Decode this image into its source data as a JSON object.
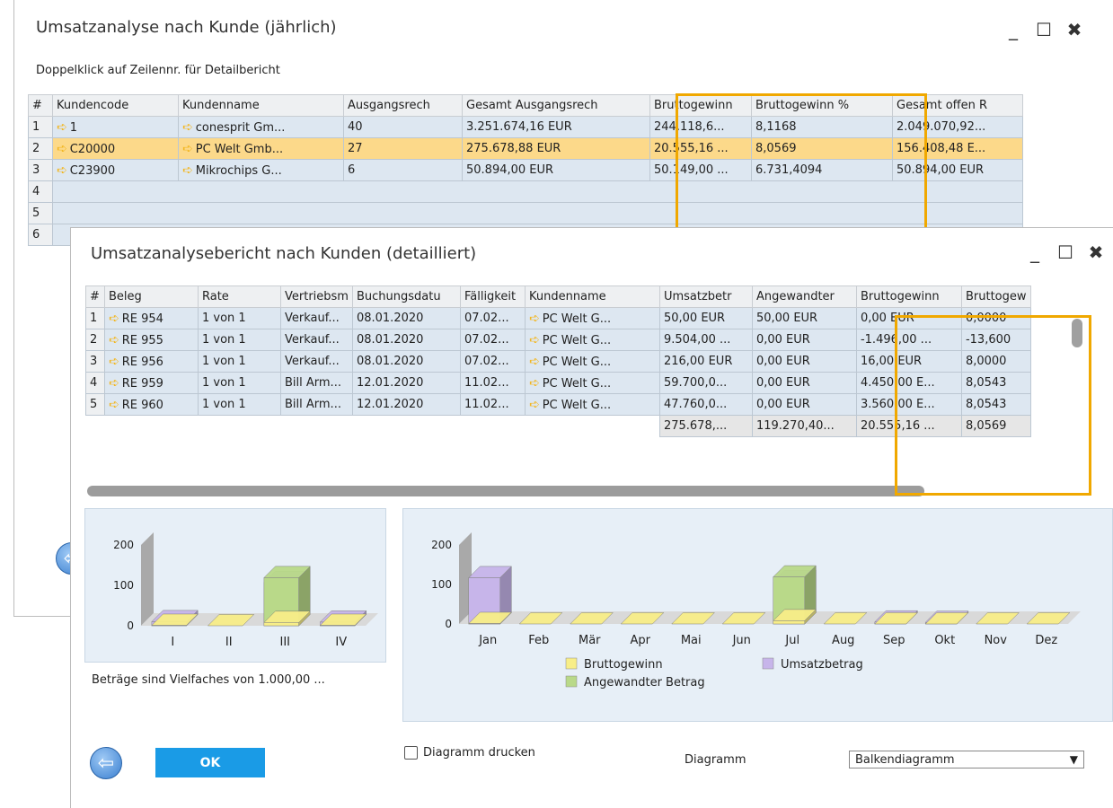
{
  "win1": {
    "title": "Umsatzanalyse nach Kunde (jährlich)",
    "hint": "Doppelklick auf Zeilennr. für Detailbericht",
    "columns": [
      "#",
      "Kundencode",
      "Kundenname",
      "Ausgangsrech",
      "Gesamt Ausgangsrech",
      "Bruttogewinn",
      "Bruttogewinn %",
      "Gesamt offen R"
    ],
    "rows": [
      {
        "n": "1",
        "code": "1",
        "name": "conesprit Gm...",
        "count": "40",
        "total": "3.251.674,16 EUR",
        "gross": "244.118,6...",
        "pct": "8,1168",
        "open": "2.049.070,92..."
      },
      {
        "n": "2",
        "code": "C20000",
        "name": "PC Welt Gmb...",
        "count": "27",
        "total": "275.678,88 EUR",
        "gross": "20.555,16 ...",
        "pct": "8,0569",
        "open": "156.408,48 E..."
      },
      {
        "n": "3",
        "code": "C23900",
        "name": "Mikrochips G...",
        "count": "6",
        "total": "50.894,00 EUR",
        "gross": "50.149,00 ...",
        "pct": "6.731,4094",
        "open": "50.894,00 EUR"
      }
    ],
    "extra_rows": [
      "4",
      "5",
      "6"
    ]
  },
  "win2": {
    "title": "Umsatzanalysebericht nach Kunden (detailliert)",
    "columns": [
      "#",
      "Beleg",
      "Rate",
      "Vertriebsm",
      "Buchungsdatu",
      "Fälligkeit",
      "Kundenname",
      "Umsatzbetr",
      "Angewandter",
      "Bruttogewinn",
      "Bruttogew"
    ],
    "rows": [
      {
        "n": "1",
        "beleg": "RE 954",
        "rate": "1 von 1",
        "vm": "Verkauf...",
        "date": "08.01.2020",
        "due": "07.02...",
        "cust": "PC Welt G...",
        "umsatz": "50,00 EUR",
        "angew": "50,00 EUR",
        "gross": "0,00 EUR",
        "pct": "0,0000"
      },
      {
        "n": "2",
        "beleg": "RE 955",
        "rate": "1 von 1",
        "vm": "Verkauf...",
        "date": "08.01.2020",
        "due": "07.02...",
        "cust": "PC Welt G...",
        "umsatz": "9.504,00 ...",
        "angew": "0,00 EUR",
        "gross": "-1.496,00 ...",
        "pct": "-13,600"
      },
      {
        "n": "3",
        "beleg": "RE 956",
        "rate": "1 von 1",
        "vm": "Verkauf...",
        "date": "08.01.2020",
        "due": "07.02...",
        "cust": "PC Welt G...",
        "umsatz": "216,00 EUR",
        "angew": "0,00 EUR",
        "gross": "16,00 EUR",
        "pct": "8,0000"
      },
      {
        "n": "4",
        "beleg": "RE 959",
        "rate": "1 von 1",
        "vm": "Bill Arm...",
        "date": "12.01.2020",
        "due": "11.02...",
        "cust": "PC Welt G...",
        "umsatz": "59.700,0...",
        "angew": "0,00 EUR",
        "gross": "4.450,00 E...",
        "pct": "8,0543"
      },
      {
        "n": "5",
        "beleg": "RE 960",
        "rate": "1 von 1",
        "vm": "Bill Arm...",
        "date": "12.01.2020",
        "due": "11.02...",
        "cust": "PC Welt G...",
        "umsatz": "47.760,0...",
        "angew": "0,00 EUR",
        "gross": "3.560,00 E...",
        "pct": "8,0543"
      }
    ],
    "totals": {
      "umsatz": "275.678,...",
      "angew": "119.270,40...",
      "gross": "20.555,16 ...",
      "pct": "8,0569"
    },
    "note": "Beträge sind Vielfaches von 1.000,00 ...",
    "ok_label": "OK",
    "print_label": "Diagramm drucken",
    "diagram_label": "Diagramm",
    "diagram_value": "Balkendiagramm",
    "legend": [
      "Bruttogewinn",
      "Umsatzbetrag",
      "Angewandter Betrag"
    ]
  },
  "colors": {
    "bruttogewinn": "#f8ee88",
    "umsatzbetrag": "#c7b5ea",
    "angewandter": "#b9d989",
    "highlight": "#f0a800",
    "ok": "#1a9be6"
  },
  "chart_data": [
    {
      "type": "bar",
      "categories": [
        "I",
        "II",
        "III",
        "IV"
      ],
      "series": [
        {
          "name": "Umsatzbetrag",
          "values": [
            10,
            0,
            107,
            9
          ]
        },
        {
          "name": "Angewandter Betrag",
          "values": [
            0,
            0,
            119,
            0
          ]
        },
        {
          "name": "Bruttogewinn",
          "values": [
            1,
            0,
            8,
            1
          ]
        }
      ],
      "yticks": [
        0,
        100,
        200
      ],
      "ylim": [
        0,
        200
      ]
    },
    {
      "type": "bar",
      "categories": [
        "Jan",
        "Feb",
        "Mär",
        "Apr",
        "Mai",
        "Jun",
        "Jul",
        "Aug",
        "Sep",
        "Okt",
        "Nov",
        "Dez"
      ],
      "series": [
        {
          "name": "Umsatzbetrag",
          "values": [
            117,
            0,
            0,
            0,
            0,
            0,
            107,
            0,
            5,
            4,
            0,
            0
          ]
        },
        {
          "name": "Angewandter Betrag",
          "values": [
            0,
            0,
            0,
            0,
            0,
            0,
            119,
            0,
            0,
            0,
            0,
            0
          ]
        },
        {
          "name": "Bruttogewinn",
          "values": [
            1,
            0,
            0,
            0,
            0,
            0,
            8,
            0,
            0,
            0,
            0,
            0
          ]
        }
      ],
      "yticks": [
        0,
        100,
        200
      ],
      "ylim": [
        0,
        200
      ]
    }
  ]
}
